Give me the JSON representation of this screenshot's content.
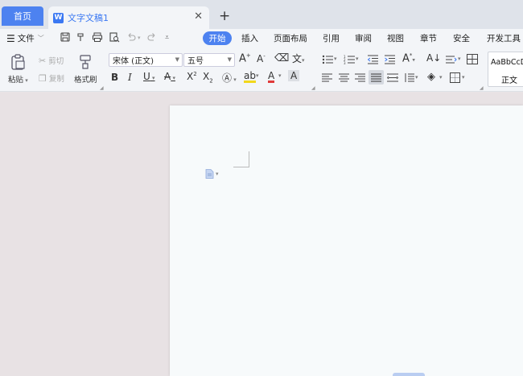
{
  "tabs": {
    "home_label": "首页",
    "document_title": "文字文稿1",
    "doc_badge": "W",
    "close_glyph": "✕",
    "add_glyph": "+"
  },
  "menu": {
    "file_label": "文件",
    "items": [
      "开始",
      "插入",
      "页面布局",
      "引用",
      "审阅",
      "视图",
      "章节",
      "安全",
      "开发工具"
    ],
    "active_item": "开始"
  },
  "ribbon": {
    "paste_label": "粘贴",
    "cut_label": "剪切",
    "copy_label": "复制",
    "format_painter_label": "格式刷",
    "font_name": "宋体 (正文)",
    "font_size": "五号",
    "style_preview": "AaBbCcD",
    "style_name": "正文"
  },
  "colors": {
    "accent": "#4d82f0",
    "tabbar_bg": "#dfe3ea",
    "ribbon_bg": "#f3f5f8",
    "canvas_bg": "#e8e2e4",
    "page_bg": "#f7fafb",
    "font_color_red": "#e03a3a",
    "highlight_yellow": "#f2d81c"
  },
  "icons": {
    "save": "save-icon",
    "undo": "undo-icon",
    "redo": "redo-icon",
    "print": "print-icon",
    "preview": "print-preview-icon"
  }
}
